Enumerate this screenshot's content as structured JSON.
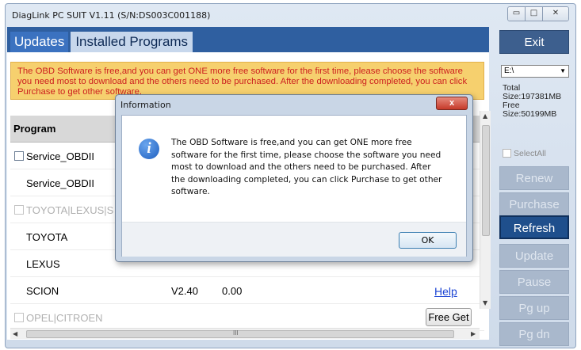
{
  "window": {
    "title": "DiagLink PC SUIT V1.11  (S/N:DS003C001188)",
    "minimize_glyph": "▭",
    "maximize_glyph": "□",
    "close_glyph": "✕"
  },
  "tabs": [
    {
      "label": "Updates",
      "active": true
    },
    {
      "label": "Installed Programs",
      "active": false
    }
  ],
  "notice": {
    "text": "The OBD Software is free,and you can get ONE more free software for the first time, please choose the software you need most to download and the others need to be purchased. After the downloading completed, you can click Purchase to get other software.",
    "color": "#cc1f1f",
    "background": "#f6d06e"
  },
  "grid": {
    "header": "Program",
    "rows": [
      {
        "name": "Service_OBDII",
        "checkbox": true,
        "group": false,
        "version": "",
        "price": "",
        "action": ""
      },
      {
        "name": "Service_OBDII",
        "checkbox": false,
        "group": false,
        "version": "",
        "price": "",
        "action": ""
      },
      {
        "name": "TOYOTA|LEXUS|S",
        "checkbox": true,
        "group": true,
        "version": "",
        "price": "",
        "action": ""
      },
      {
        "name": "TOYOTA",
        "checkbox": false,
        "group": false,
        "version": "",
        "price": "",
        "action": ""
      },
      {
        "name": "LEXUS",
        "checkbox": false,
        "group": false,
        "version": "",
        "price": "",
        "action": ""
      },
      {
        "name": "SCION",
        "checkbox": false,
        "group": false,
        "version": "V2.40",
        "price": "0.00",
        "action": "Help"
      },
      {
        "name": "OPEL|CITROEN",
        "checkbox": true,
        "group": true,
        "version": "",
        "price": "",
        "action": "Free Get"
      }
    ]
  },
  "sidebar": {
    "exit_label": "Exit",
    "drive_value": "E:\\",
    "disk_total": "Total Size:197381MB",
    "disk_free": "Free Size:50199MB",
    "select_all_label": "SelectAll",
    "buttons": [
      {
        "label": "Renew",
        "state": "disabled"
      },
      {
        "label": "Purchase",
        "state": "disabled"
      },
      {
        "label": "Refresh",
        "state": "active"
      },
      {
        "label": "Update",
        "state": "disabled"
      },
      {
        "label": "Pause",
        "state": "disabled"
      },
      {
        "label": "Pg up",
        "state": "disabled"
      },
      {
        "label": "Pg dn",
        "state": "disabled"
      }
    ]
  },
  "dialog": {
    "title": "Information",
    "close_glyph": "x",
    "icon_glyph": "i",
    "message": "The OBD Software is free,and you can get ONE more free software for the first time, please choose the software you need most to download and the others need to be purchased. After the downloading completed, you can click Purchase to get other software.",
    "ok_label": "OK"
  },
  "scrollbar": {
    "h_thumb_glyph": "III"
  }
}
